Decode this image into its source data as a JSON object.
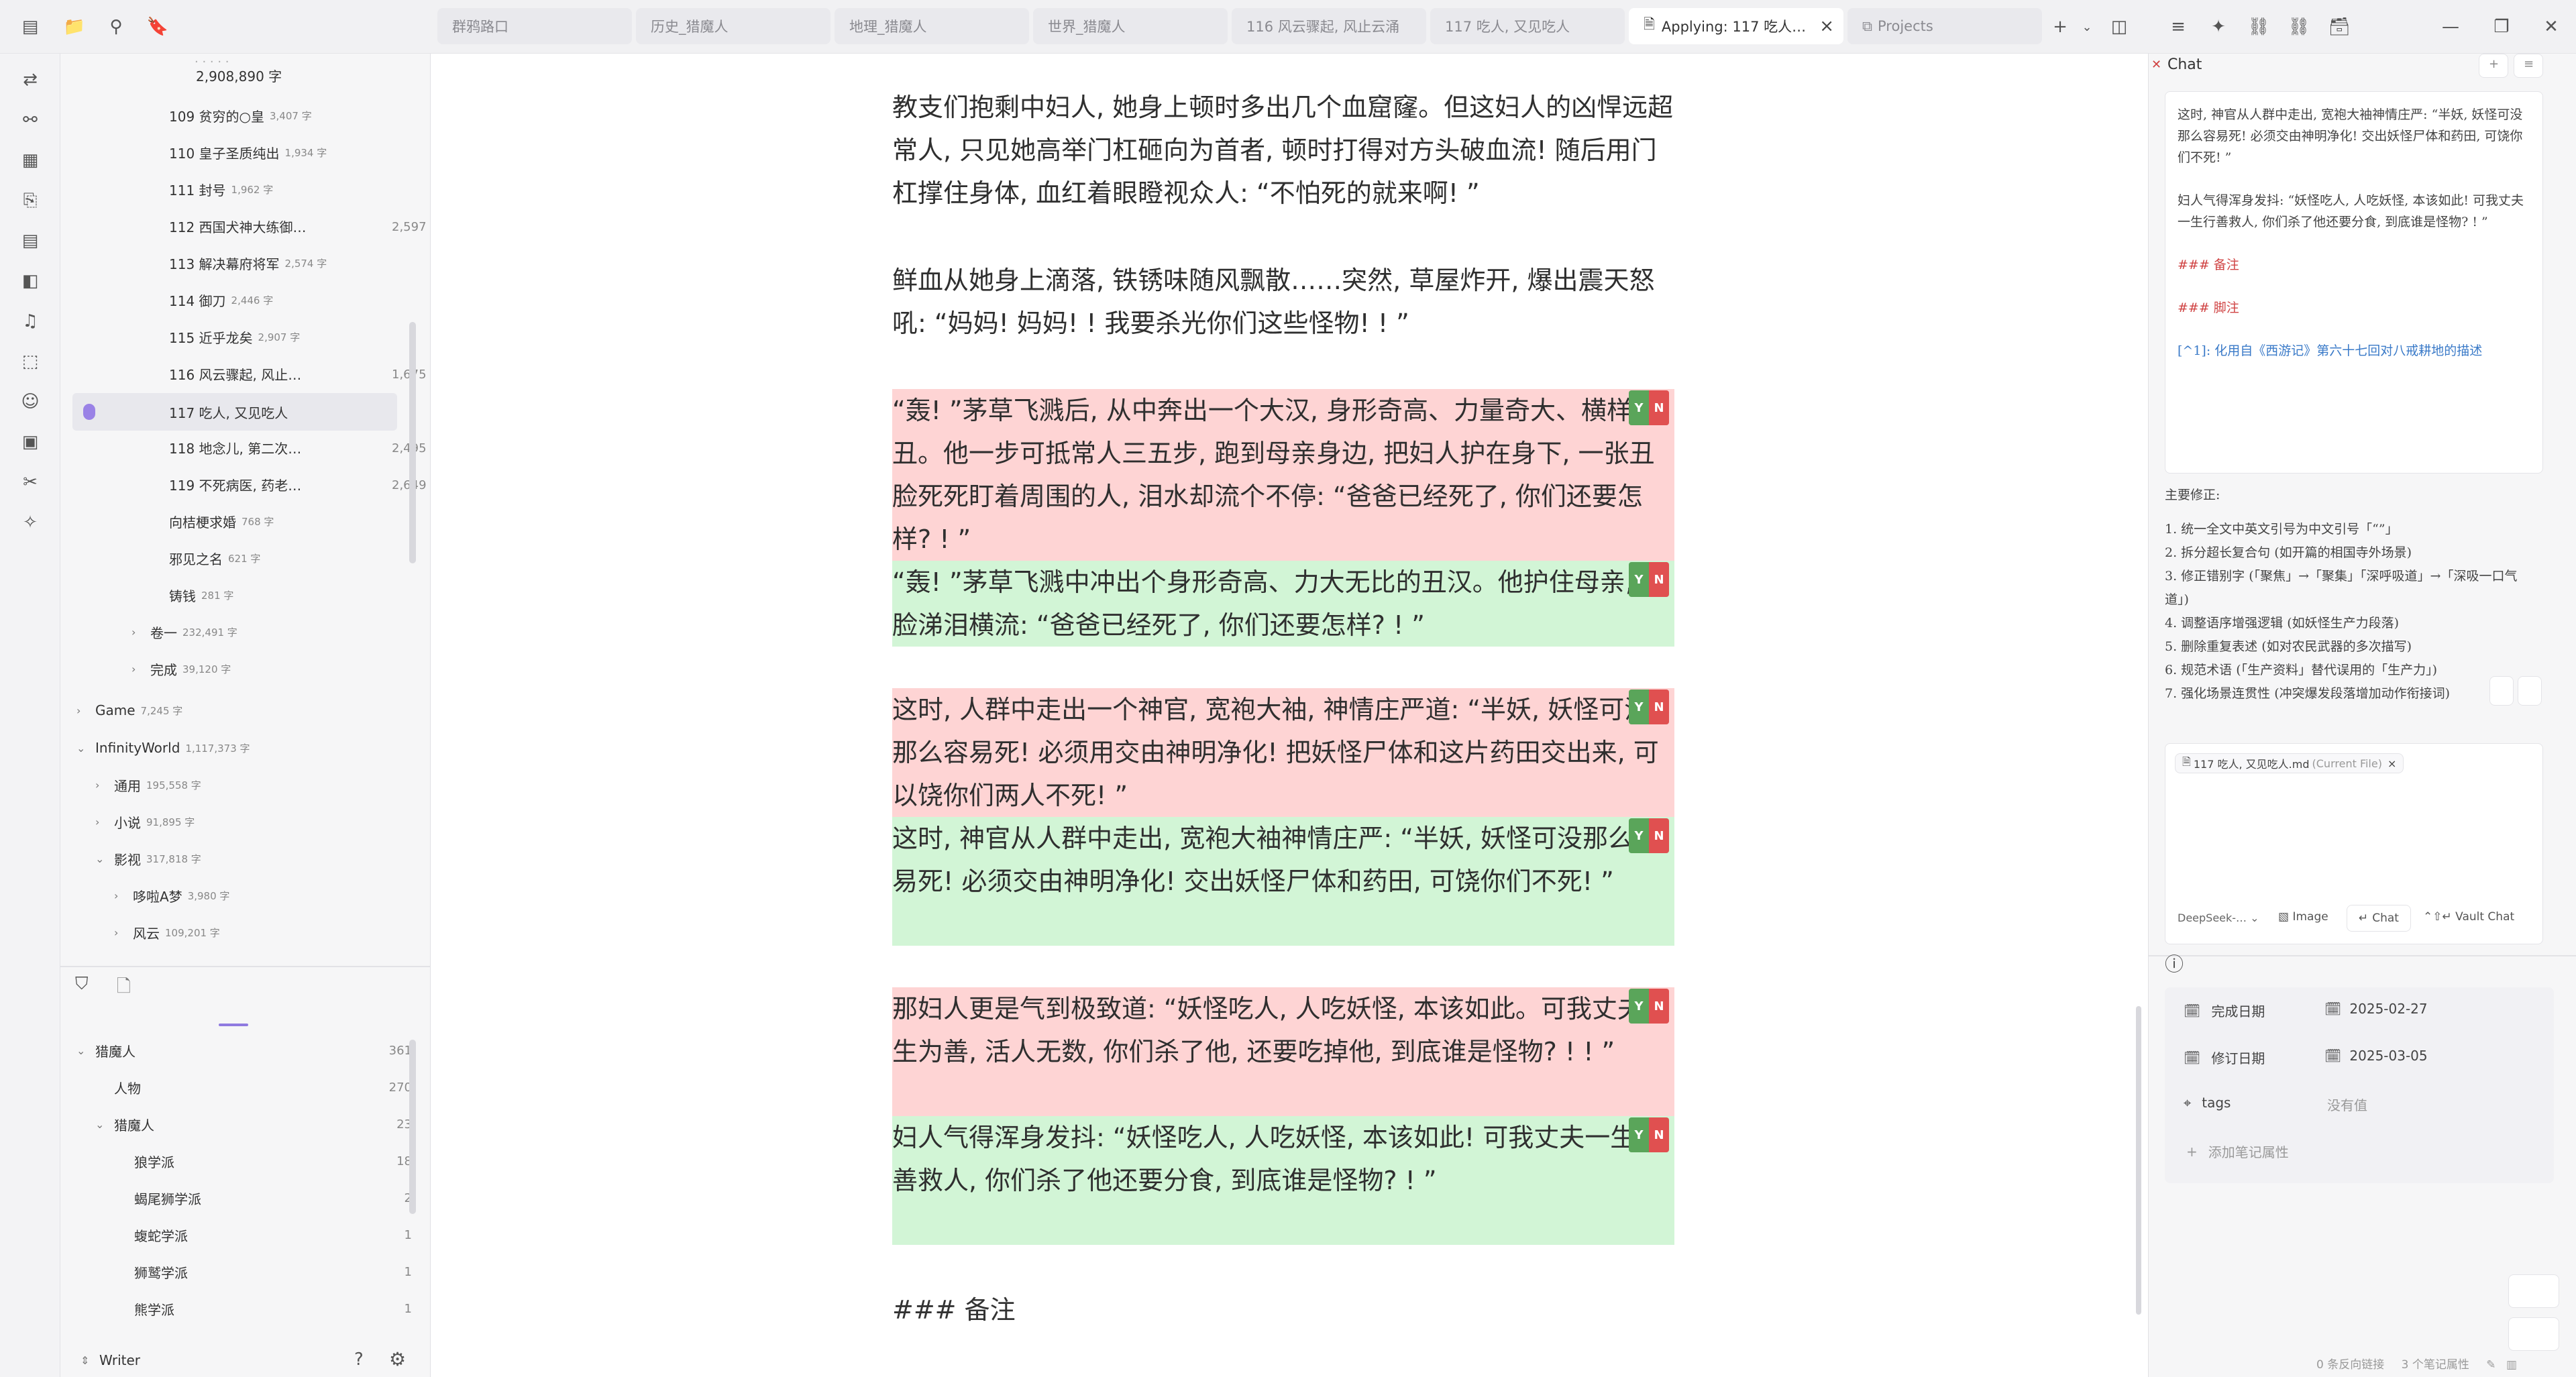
{
  "tabs": [
    {
      "label": "群鸦路口"
    },
    {
      "label": "历史_猎魔人"
    },
    {
      "label": "地理_猎魔人"
    },
    {
      "label": "世界_猎魔人"
    },
    {
      "label": "116 风云骤起, 风止云涌"
    },
    {
      "label": "117 吃人, 又见吃人"
    },
    {
      "label": "Applying: 117 吃人…"
    },
    {
      "label": "Projects"
    }
  ],
  "file_tree": {
    "top_count": "2,908,890 字",
    "chapters": [
      {
        "title": "109 贫穷的○皇",
        "count": "3,407 字"
      },
      {
        "title": "110 皇子圣质纯出",
        "count": "1,934 字"
      },
      {
        "title": "111 封号",
        "count": "1,962 字"
      },
      {
        "title": "112 西国犬神大练御…",
        "count": "2,597 字"
      },
      {
        "title": "113 解决幕府将军",
        "count": "2,574 字"
      },
      {
        "title": "114 御刀",
        "count": "2,446 字"
      },
      {
        "title": "115 近乎龙矣",
        "count": "2,907 字"
      },
      {
        "title": "116 风云骤起, 风止…",
        "count": "1,675 字"
      },
      {
        "title": "117 吃人, 又见吃人",
        "count": ""
      },
      {
        "title": "118 地念儿, 第二次…",
        "count": "2,495 字"
      },
      {
        "title": "119 不死病医, 药老…",
        "count": "2,649 字"
      },
      {
        "title": "向桔梗求婚",
        "count": "768 字"
      },
      {
        "title": "邪见之名",
        "count": "621 字"
      },
      {
        "title": "铸钱",
        "count": "281 字"
      }
    ],
    "folders": [
      {
        "title": "卷一",
        "count": "232,491 字"
      },
      {
        "title": "完成",
        "count": "39,120 字"
      },
      {
        "title": "Game",
        "count": "7,245 字"
      },
      {
        "title": "InfinityWorld",
        "count": "1,117,373 字"
      },
      {
        "title": "通用",
        "count": "195,558 字"
      },
      {
        "title": "小说",
        "count": "91,895 字"
      },
      {
        "title": "影视",
        "count": "317,818 字"
      },
      {
        "title": "哆啦A梦",
        "count": "3,980 字"
      },
      {
        "title": "风云",
        "count": "109,201 字"
      }
    ]
  },
  "tags": {
    "items": [
      {
        "label": "猎魔人",
        "count": "361"
      },
      {
        "label": "人物",
        "count": "270"
      },
      {
        "label": "猎魔人",
        "count": "23"
      },
      {
        "label": "狼学派",
        "count": "18"
      },
      {
        "label": "蝎尾狮学派",
        "count": "2"
      },
      {
        "label": "蝮蛇学派",
        "count": "1"
      },
      {
        "label": "狮鹫学派",
        "count": "1"
      },
      {
        "label": "熊学派",
        "count": "1"
      }
    ]
  },
  "vault": {
    "name": "Writer"
  },
  "editor": {
    "p1": "教支们抱剩中妇人, 她身上顿时多出几个血窟窿。但这妇人的凶悍远超常人, 只见她高举门杠砸向为首者, 顿时打得对方头破血流! 随后用门杠撑住身体, 血红着眼瞪视众人: “不怕死的就来啊! ”",
    "p2": "鲜血从她身上滴落, 铁锈味随风飘散……突然, 草屋炸开, 爆出震天怒吼: “妈妈! 妈妈! ! 我要杀光你们这些怪物! ! ”",
    "d1_old": "“轰! ”茅草飞溅后, 从中奔出一个大汉, 身形奇高、力量奇大、横样奇丑。他一步可抵常人三五步, 跑到母亲身边, 把妇人护在身下, 一张丑脸死死盯着周围的人, 泪水却流个不停: “爸爸已经死了, 你们还要怎样? ! ”",
    "d1_new": "“轰! ”茅草飞溅中冲出个身形奇高、力大无比的丑汉。他护住母亲, 丑脸涕泪横流: “爸爸已经死了, 你们还要怎样? ! ”",
    "d2_old": "这时, 人群中走出一个神官, 宽袍大袖, 神情庄严道: “半妖, 妖怪可没那么容易死! 必须用交由神明净化! 把妖怪尸体和这片药田交出来, 可以饶你们两人不死! ”",
    "d2_new": "这时, 神官从人群中走出, 宽袍大袖神情庄严: “半妖, 妖怪可没那么容易死! 必须交由神明净化! 交出妖怪尸体和药田, 可饶你们不死! ”",
    "d3_old": "那妇人更是气到极致道: “妖怪吃人, 人吃妖怪, 本该如此。可我丈夫一生为善, 活人无数, 你们杀了他, 还要吃掉他, 到底谁是怪物? ! ! ”",
    "d3_new": "妇人气得浑身发抖: “妖怪吃人, 人吃妖怪, 本该如此! 可我丈夫一生行善救人, 你们杀了他还要分食, 到底谁是怪物? ! ”",
    "heading": "### 备注",
    "accept": "Y",
    "reject": "N"
  },
  "chat": {
    "title": "Chat",
    "quote1": "这时, 神官从人群中走出, 宽袍大袖神情庄严: “半妖, 妖怪可没那么容易死! 必须交由神明净化! 交出妖怪尸体和药田, 可饶你们不死! ”",
    "quote2": "妇人气得浑身发抖: “妖怪吃人, 人吃妖怪, 本该如此! 可我丈夫一生行善救人, 你们杀了他还要分食, 到底谁是怪物? ! ”",
    "h_note": "### 备注",
    "h_foot": "### 脚注",
    "footnote": "[^1]: 化用自《西游记》第六十七回对八戒耕地的描述",
    "summary_title": "主要修正:",
    "fixes": [
      "1. 统一全文中英文引号为中文引号「“”」",
      "2. 拆分超长复合句 (如开篇的相国寺外场景)",
      "3. 修正错别字 (「聚焦」→「聚集」「深呼吸道」→「深吸一口气道」)",
      "4. 调整语序增强逻辑 (如妖怪生产力段落)",
      "5. 删除重复表述 (如对农民武器的多次描写)",
      "6. 规范术语 (「生产资料」替代误用的「生产力」)",
      "7. 强化场景连贯性 (冲突爆发段落增加动作衔接词)"
    ],
    "file_chip": "117 吃人, 又见吃人.md",
    "file_chip_tag": "(Current File)",
    "model": "DeepSeek-…",
    "image_btn": "Image",
    "chat_btn": "Chat",
    "vault_chat_btn": "Vault Chat"
  },
  "properties": {
    "done_label": "完成日期",
    "done_value": "2025-02-27",
    "rev_label": "修订日期",
    "rev_value": "2025-03-05",
    "tags_label": "tags",
    "tags_value": "没有值",
    "add_label": "添加笔记属性"
  },
  "status_bar": {
    "backlinks": "0 条反向链接",
    "props": "3 个笔记属性"
  }
}
